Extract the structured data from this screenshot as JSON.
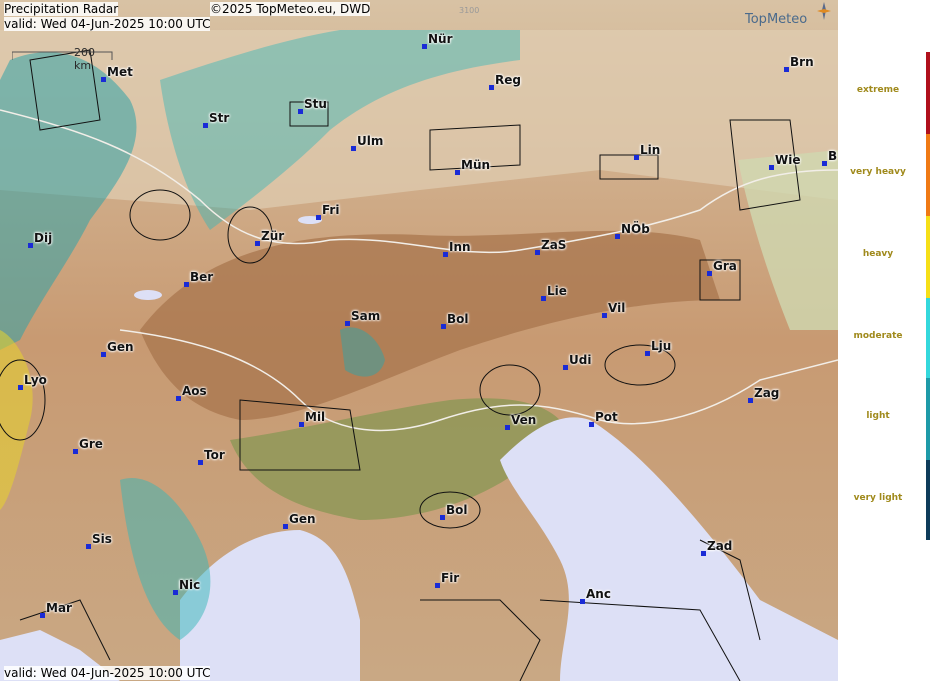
{
  "header": {
    "title": "Precipitation Radar",
    "copyright": "©2025 TopMeteo.eu, DWD",
    "code": "3100",
    "valid_top": "valid:  Wed  04-Jun-2025 10:00 UTC",
    "valid_bottom": "valid:  Wed  04-Jun-2025 10:00 UTC"
  },
  "logo": {
    "text": "TopMeteo"
  },
  "scale": {
    "label": "200 km"
  },
  "legend": {
    "items": [
      {
        "label": "extreme",
        "color": "#b0101c"
      },
      {
        "label": "very heavy",
        "color": "#f07a14"
      },
      {
        "label": "heavy",
        "color": "#f6df18"
      },
      {
        "label": "moderate",
        "color": "#34d8dc"
      },
      {
        "label": "light",
        "color": "#1e9aa8"
      },
      {
        "label": "very light",
        "color": "#0e3c5a"
      }
    ]
  },
  "cities": [
    {
      "name": "Nür"
    },
    {
      "name": "Met"
    },
    {
      "name": "Reg"
    },
    {
      "name": "Brn"
    },
    {
      "name": "Stu"
    },
    {
      "name": "Str"
    },
    {
      "name": "Ulm"
    },
    {
      "name": "Lin"
    },
    {
      "name": "Mün"
    },
    {
      "name": "Wie"
    },
    {
      "name": "B"
    },
    {
      "name": "Fri"
    },
    {
      "name": "Dij"
    },
    {
      "name": "Zür"
    },
    {
      "name": "Inn"
    },
    {
      "name": "ZaS"
    },
    {
      "name": "NÖb"
    },
    {
      "name": "Ber"
    },
    {
      "name": "Gra"
    },
    {
      "name": "Lie"
    },
    {
      "name": "Sam"
    },
    {
      "name": "Bol"
    },
    {
      "name": "Vil"
    },
    {
      "name": "Gen"
    },
    {
      "name": "Lju"
    },
    {
      "name": "Udi"
    },
    {
      "name": "Lyo"
    },
    {
      "name": "Aos"
    },
    {
      "name": "Zag"
    },
    {
      "name": "Mil"
    },
    {
      "name": "Ven"
    },
    {
      "name": "Pot"
    },
    {
      "name": "Gre"
    },
    {
      "name": "Tor"
    },
    {
      "name": "Gen"
    },
    {
      "name": "Bol"
    },
    {
      "name": "Sis"
    },
    {
      "name": "Zad"
    },
    {
      "name": "Fir"
    },
    {
      "name": "Nic"
    },
    {
      "name": "Anc"
    },
    {
      "name": "Mar"
    }
  ]
}
